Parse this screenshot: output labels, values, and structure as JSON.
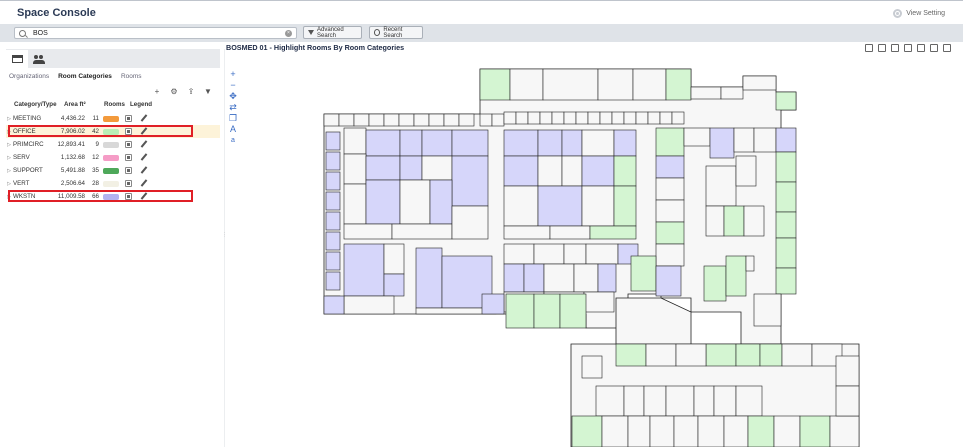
{
  "app": {
    "title": "Space Console",
    "view_setting": "View Setting"
  },
  "search": {
    "value": "BOS",
    "advanced_label": "Advanced Search",
    "recent_label": "Recent Search"
  },
  "left_panel": {
    "subtabs": [
      "Organizations",
      "Room Categories",
      "Rooms"
    ],
    "active_subtab": "Room Categories",
    "columns": {
      "category": "Category/Type",
      "area": "Area ft²",
      "rooms": "Rooms",
      "legend": "Legend"
    },
    "rows": [
      {
        "name": "MEETING",
        "area": "4,436.22",
        "rooms": "11",
        "color": "#f39a3c"
      },
      {
        "name": "OFFICE",
        "area": "7,906.02",
        "rooms": "42",
        "color": "#b9efb6"
      },
      {
        "name": "PRIMCIRC",
        "area": "12,893.41",
        "rooms": "9",
        "color": "#d8d8d8"
      },
      {
        "name": "SERV",
        "area": "1,132.68",
        "rooms": "12",
        "color": "#f59cc6"
      },
      {
        "name": "SUPPORT",
        "area": "5,491.88",
        "rooms": "35",
        "color": "#4ea85a"
      },
      {
        "name": "VERT",
        "area": "2,506.64",
        "rooms": "28",
        "color": "#f2f0e4"
      },
      {
        "name": "WKSTN",
        "area": "11,009.58",
        "rooms": "66",
        "color": "#b3b3f0"
      }
    ]
  },
  "map": {
    "title": "BOSMED 01 - Highlight Rooms By Room Categories",
    "colors": {
      "wkstn": "#d6d6fa",
      "office": "#d4f5d2",
      "default": "#f7f7f7",
      "wall": "#222222"
    }
  },
  "colors": {
    "brand_title": "#2b3a55",
    "highlight_border": "#e01f26",
    "selected_row": "#fdf3d9"
  }
}
